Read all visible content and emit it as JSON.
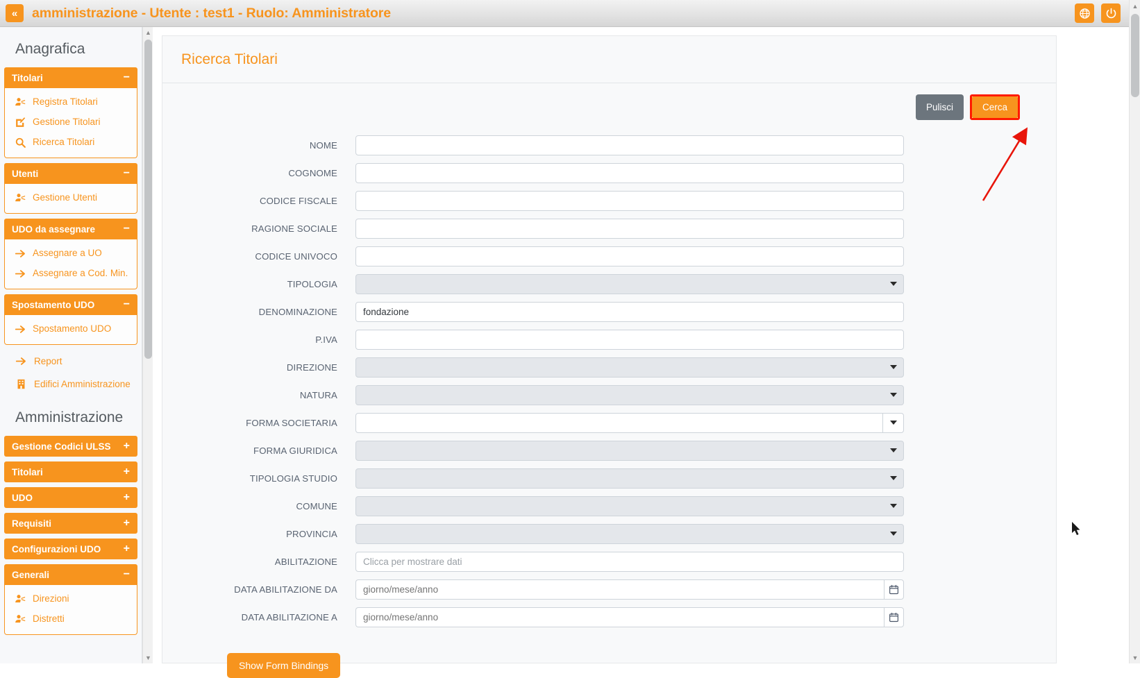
{
  "topbar": {
    "collapse_label": "«",
    "title": "amministrazione - Utente : test1 - Ruolo: Amministratore",
    "language_icon": "globe-icon",
    "logout_icon": "power-icon"
  },
  "sidebar": {
    "sections": [
      {
        "heading": "Anagrafica",
        "panels": [
          {
            "title": "Titolari",
            "sign": "−",
            "expanded": true,
            "items": [
              {
                "label": "Registra Titolari",
                "icon": "user-add-icon"
              },
              {
                "label": "Gestione Titolari",
                "icon": "edit-square-icon"
              },
              {
                "label": "Ricerca Titolari",
                "icon": "search-icon"
              }
            ]
          },
          {
            "title": "Utenti",
            "sign": "−",
            "expanded": true,
            "items": [
              {
                "label": "Gestione Utenti",
                "icon": "user-add-icon"
              }
            ]
          },
          {
            "title": "UDO da assegnare",
            "sign": "−",
            "expanded": true,
            "items": [
              {
                "label": "Assegnare a UO",
                "icon": "arrow-right-icon"
              },
              {
                "label": "Assegnare a Cod. Min.",
                "icon": "arrow-right-icon"
              }
            ]
          },
          {
            "title": "Spostamento UDO",
            "sign": "−",
            "expanded": true,
            "items": [
              {
                "label": "Spostamento UDO",
                "icon": "arrow-right-icon"
              }
            ]
          }
        ],
        "plain_links": [
          {
            "label": "Report",
            "icon": "arrow-right-icon"
          },
          {
            "label": "Edifici Amministrazione",
            "icon": "building-icon"
          }
        ]
      },
      {
        "heading": "Amministrazione",
        "panels": [
          {
            "title": "Gestione Codici ULSS",
            "sign": "+",
            "expanded": false,
            "items": []
          },
          {
            "title": "Titolari",
            "sign": "+",
            "expanded": false,
            "items": []
          },
          {
            "title": "UDO",
            "sign": "+",
            "expanded": false,
            "items": []
          },
          {
            "title": "Requisiti",
            "sign": "+",
            "expanded": false,
            "items": []
          },
          {
            "title": "Configurazioni UDO",
            "sign": "+",
            "expanded": false,
            "items": []
          },
          {
            "title": "Generali",
            "sign": "−",
            "expanded": true,
            "items": [
              {
                "label": "Direzioni",
                "icon": "user-add-icon"
              },
              {
                "label": "Distretti",
                "icon": "user-add-icon"
              }
            ]
          }
        ],
        "plain_links": []
      }
    ]
  },
  "main": {
    "page_title": "Ricerca Titolari",
    "actions": {
      "clear_label": "Pulisci",
      "search_label": "Cerca",
      "search_highlight_color": "#ff1a00"
    },
    "form": {
      "fields": [
        {
          "label": "NOME",
          "type": "text",
          "value": "",
          "placeholder": "",
          "disabled": false
        },
        {
          "label": "COGNOME",
          "type": "text",
          "value": "",
          "placeholder": "",
          "disabled": false
        },
        {
          "label": "CODICE FISCALE",
          "type": "text",
          "value": "",
          "placeholder": "",
          "disabled": false
        },
        {
          "label": "RAGIONE SOCIALE",
          "type": "text",
          "value": "",
          "placeholder": "",
          "disabled": false
        },
        {
          "label": "CODICE UNIVOCO",
          "type": "text",
          "value": "",
          "placeholder": "",
          "disabled": false
        },
        {
          "label": "TIPOLOGIA",
          "type": "select",
          "value": "",
          "placeholder": "",
          "disabled": true
        },
        {
          "label": "DENOMINAZIONE",
          "type": "text",
          "value": "fondazione",
          "placeholder": "",
          "disabled": false
        },
        {
          "label": "P.IVA",
          "type": "text",
          "value": "",
          "placeholder": "",
          "disabled": false
        },
        {
          "label": "DIREZIONE",
          "type": "select",
          "value": "",
          "placeholder": "",
          "disabled": true
        },
        {
          "label": "NATURA",
          "type": "select",
          "value": "",
          "placeholder": "",
          "disabled": true
        },
        {
          "label": "FORMA SOCIETARIA",
          "type": "select-boxed",
          "value": "",
          "placeholder": "",
          "disabled": false
        },
        {
          "label": "FORMA GIURIDICA",
          "type": "select",
          "value": "",
          "placeholder": "",
          "disabled": true
        },
        {
          "label": "TIPOLOGIA STUDIO",
          "type": "select",
          "value": "",
          "placeholder": "",
          "disabled": true
        },
        {
          "label": "COMUNE",
          "type": "select",
          "value": "",
          "placeholder": "",
          "disabled": true
        },
        {
          "label": "PROVINCIA",
          "type": "select",
          "value": "",
          "placeholder": "",
          "disabled": true
        },
        {
          "label": "ABILITAZIONE",
          "type": "text",
          "value": "",
          "placeholder": "Clicca per mostrare dati",
          "disabled": false
        },
        {
          "label": "DATA ABILITAZIONE DA",
          "type": "date",
          "value": "",
          "placeholder": "giorno/mese/anno",
          "disabled": false
        },
        {
          "label": "DATA ABILITAZIONE A",
          "type": "date",
          "value": "",
          "placeholder": "giorno/mese/anno",
          "disabled": false
        }
      ],
      "bindings_button_label": "Show Form Bindings"
    }
  },
  "colors": {
    "brand_orange": "#f7941e",
    "grey_button": "#6c757d",
    "annotation_red": "#e8150a",
    "disabled_field": "#e4e7eb"
  }
}
